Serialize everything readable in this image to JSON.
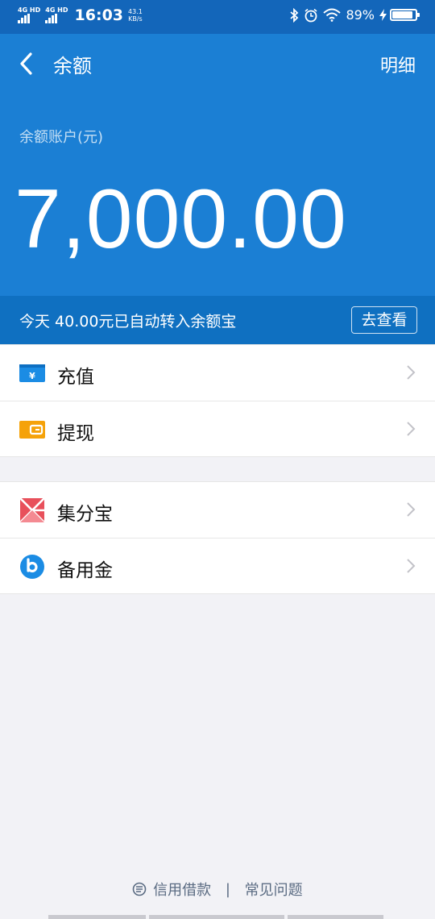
{
  "status_bar": {
    "sim1": "4G HD",
    "sim2": "4G HD",
    "time": "16:03",
    "net_speed_value": "43.1",
    "net_speed_unit": "KB/s",
    "battery_percent_text": "89%",
    "battery_level": 0.89,
    "icons": [
      "bluetooth-icon",
      "alarm-icon",
      "wifi-icon",
      "charging-icon",
      "battery-icon"
    ]
  },
  "header": {
    "back_icon": "chevron-left-icon",
    "title": "余额",
    "detail_label": "明细"
  },
  "balance": {
    "label": "余额账户(元)",
    "amount": "7,000.00"
  },
  "notice": {
    "text": "今天 40.00元已自动转入余额宝",
    "button_label": "去查看"
  },
  "menu_group_1": [
    {
      "label": "充值",
      "icon": "recharge-card-icon",
      "icon_color": "#1b8ce4"
    },
    {
      "label": "提现",
      "icon": "wallet-icon",
      "icon_color": "#f5a20a"
    }
  ],
  "menu_group_2": [
    {
      "label": "集分宝",
      "icon": "jifenbao-icon",
      "icon_color": "#e8505b"
    },
    {
      "label": "备用金",
      "icon": "beiyongjin-icon",
      "icon_color": "#1b8ce4"
    }
  ],
  "footer": {
    "link1": "信用借款",
    "separator": "|",
    "link2": "常见问题"
  },
  "colors": {
    "header_blue": "#1b7fd4",
    "notice_blue": "#0f70c1",
    "status_blue": "#1366ba",
    "page_bg": "#f2f2f6"
  }
}
